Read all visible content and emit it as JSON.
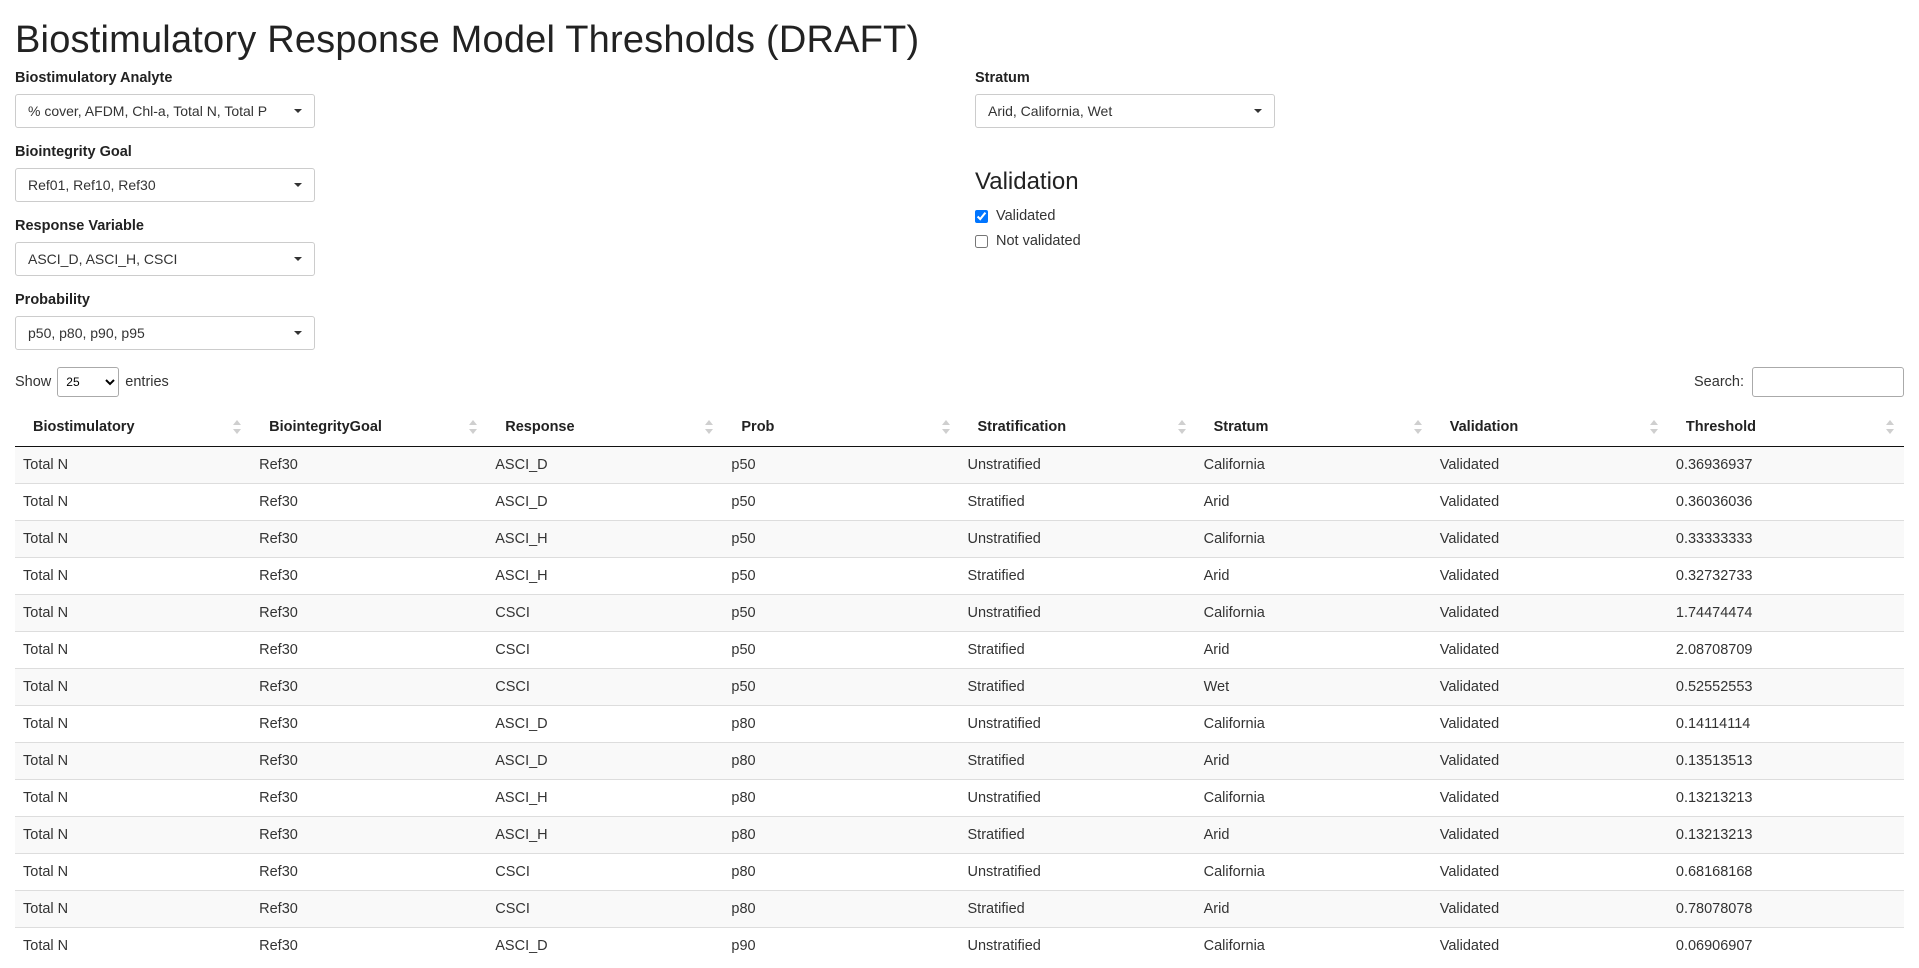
{
  "page": {
    "title": "Biostimulatory Response Model Thresholds (DRAFT)"
  },
  "filters": {
    "analyte": {
      "label": "Biostimulatory Analyte",
      "value": "% cover, AFDM, Chl-a, Total N, Total P"
    },
    "goal": {
      "label": "Biointegrity Goal",
      "value": "Ref01, Ref10, Ref30"
    },
    "response": {
      "label": "Response Variable",
      "value": "ASCI_D, ASCI_H, CSCI"
    },
    "probability": {
      "label": "Probability",
      "value": "p50, p80, p90, p95"
    },
    "stratum": {
      "label": "Stratum",
      "value": "Arid, California, Wet"
    }
  },
  "validation": {
    "heading": "Validation",
    "options": [
      {
        "label": "Validated",
        "checked": true
      },
      {
        "label": "Not validated",
        "checked": false
      }
    ]
  },
  "table_controls": {
    "show_label": "Show",
    "entries_label": "entries",
    "page_length": "25",
    "search_label": "Search:",
    "search_value": ""
  },
  "table": {
    "columns": [
      "Biostimulatory",
      "BiointegrityGoal",
      "Response",
      "Prob",
      "Stratification",
      "Stratum",
      "Validation",
      "Threshold"
    ],
    "rows": [
      [
        "Total N",
        "Ref30",
        "ASCI_D",
        "p50",
        "Unstratified",
        "California",
        "Validated",
        "0.36936937"
      ],
      [
        "Total N",
        "Ref30",
        "ASCI_D",
        "p50",
        "Stratified",
        "Arid",
        "Validated",
        "0.36036036"
      ],
      [
        "Total N",
        "Ref30",
        "ASCI_H",
        "p50",
        "Unstratified",
        "California",
        "Validated",
        "0.33333333"
      ],
      [
        "Total N",
        "Ref30",
        "ASCI_H",
        "p50",
        "Stratified",
        "Arid",
        "Validated",
        "0.32732733"
      ],
      [
        "Total N",
        "Ref30",
        "CSCI",
        "p50",
        "Unstratified",
        "California",
        "Validated",
        "1.74474474"
      ],
      [
        "Total N",
        "Ref30",
        "CSCI",
        "p50",
        "Stratified",
        "Arid",
        "Validated",
        "2.08708709"
      ],
      [
        "Total N",
        "Ref30",
        "CSCI",
        "p50",
        "Stratified",
        "Wet",
        "Validated",
        "0.52552553"
      ],
      [
        "Total N",
        "Ref30",
        "ASCI_D",
        "p80",
        "Unstratified",
        "California",
        "Validated",
        "0.14114114"
      ],
      [
        "Total N",
        "Ref30",
        "ASCI_D",
        "p80",
        "Stratified",
        "Arid",
        "Validated",
        "0.13513513"
      ],
      [
        "Total N",
        "Ref30",
        "ASCI_H",
        "p80",
        "Unstratified",
        "California",
        "Validated",
        "0.13213213"
      ],
      [
        "Total N",
        "Ref30",
        "ASCI_H",
        "p80",
        "Stratified",
        "Arid",
        "Validated",
        "0.13213213"
      ],
      [
        "Total N",
        "Ref30",
        "CSCI",
        "p80",
        "Unstratified",
        "California",
        "Validated",
        "0.68168168"
      ],
      [
        "Total N",
        "Ref30",
        "CSCI",
        "p80",
        "Stratified",
        "Arid",
        "Validated",
        "0.78078078"
      ],
      [
        "Total N",
        "Ref30",
        "ASCI_D",
        "p90",
        "Unstratified",
        "California",
        "Validated",
        "0.06906907"
      ]
    ]
  }
}
